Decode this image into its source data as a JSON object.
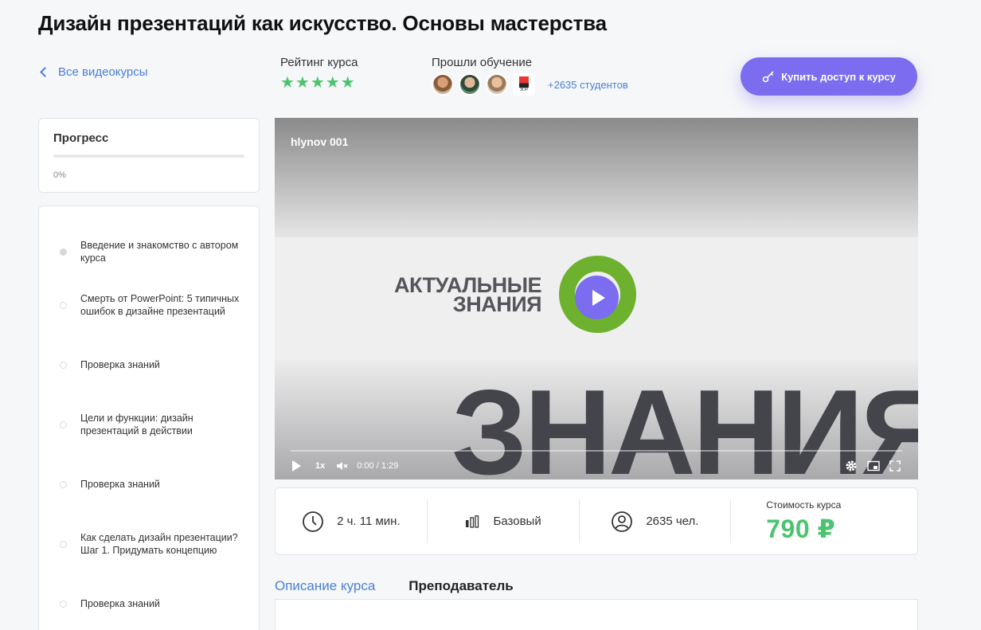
{
  "page": {
    "title": "Дизайн презентаций как искусство. Основы мастерства"
  },
  "nav": {
    "back_label": "Все видеокурсы"
  },
  "rating": {
    "label": "Рейтинг курса",
    "stars": "★★★★★",
    "value": 5
  },
  "students": {
    "label": "Прошли обучение",
    "more": "+2635 студентов",
    "badge_text": "ЭОР"
  },
  "buy": {
    "label": "Купить доступ к курсу"
  },
  "progress": {
    "title": "Прогресс",
    "percent_label": "0%",
    "fraction": 0
  },
  "lessons": [
    {
      "title": "Введение и знакомство с автором курса",
      "done": true
    },
    {
      "title": "Смерть от PowerPoint: 5 типичных ошибок в дизайне презентаций",
      "done": false
    },
    {
      "title": "Проверка знаний",
      "done": false
    },
    {
      "title": "Цели и функции: дизайн презентаций в действии",
      "done": false
    },
    {
      "title": "Проверка знаний",
      "done": false
    },
    {
      "title": "Как сделать дизайн презентации? Шаг 1. Придумать концепцию",
      "done": false
    },
    {
      "title": "Проверка знаний",
      "done": false
    }
  ],
  "video": {
    "title": "hlynov 001",
    "brand_line1": "АКТУАЛЬНЫЕ",
    "brand_line2": "ЗНАНИЯ",
    "big_word": "ЗНАНИЯ",
    "speed": "1x",
    "time": "0:00 / 1:29"
  },
  "stats": {
    "duration": "2 ч. 11 мин.",
    "level": "Базовый",
    "people": "2635 чел.",
    "price_label": "Стоимость курса",
    "price": "790 ₽"
  },
  "tabs": [
    {
      "label": "Описание курса",
      "active": true
    },
    {
      "label": "Преподаватель",
      "active": false
    }
  ],
  "colors": {
    "accent": "#7b6cf0",
    "link": "#4a7fd6",
    "green": "#4cc46f"
  }
}
